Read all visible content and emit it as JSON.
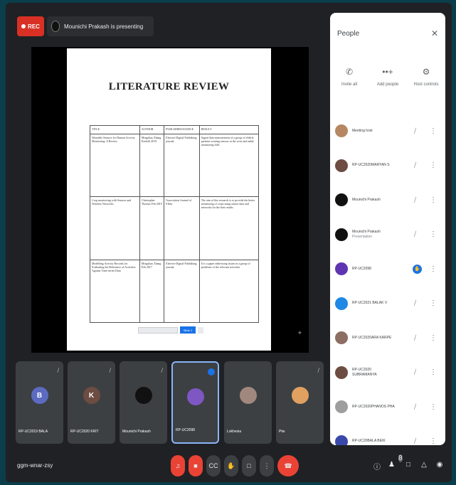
{
  "top": {
    "rec_label": "REC",
    "presenting_text": "Mounichi Prakash is presenting"
  },
  "slide": {
    "title": "LITERATURE REVIEW",
    "headers": [
      "TITLE",
      "AUTHOR",
      "PUBLISHED/SOURCE",
      "RESULT"
    ],
    "rows": [
      [
        "Wearable Sensors for Human Activity Monitoring: A Review",
        "Mingchao Zhang\n\nKatfold 2019",
        "Elsevier Digital Publishing journal",
        "Signal data measurement of a group of elderly patients wearing sensors at the wrist and ankle monitoring falls"
      ],
      [
        "Crop monitoring with Sensors and Wireless Networks",
        "Christopher Thomas\n\nFeb 2019",
        "Association Journal of Elbey",
        "The aim of this research is to provide the better monitoring of crops using sensor data and networks for the best results"
      ],
      [
        "Modelling Activity Records for Evaluating the Relevance of Activities Against Time-series Data",
        "Mingchao Zhang\n\nFeb 2017",
        "Elsevier Digital Publishing journal",
        "It is a paper addressing issues in a group of problems of the relevant activities"
      ]
    ],
    "page_label": "Slide 1"
  },
  "people_panel": {
    "title": "People",
    "actions": [
      {
        "icon": "person-add-icon",
        "label": "Invite all"
      },
      {
        "icon": "add-people-icon",
        "label": "Add people"
      },
      {
        "icon": "host-controls-icon",
        "label": "Host controls"
      }
    ],
    "participants": [
      {
        "name": "Meeting host",
        "sub": "",
        "initial": "",
        "color": "#b58863",
        "state": "mic-off"
      },
      {
        "name": "RP-UC2020MARYAN S",
        "sub": "",
        "initial": "",
        "color": "#6d4c41",
        "state": "mic-off"
      },
      {
        "name": "Mounichi Prakash",
        "sub": "",
        "initial": "",
        "color": "#111111",
        "state": "mic-off"
      },
      {
        "name": "Mounichi Prakash",
        "sub": "Presentation",
        "initial": "",
        "color": "#111111",
        "state": "mic-off"
      },
      {
        "name": "RP-UC2098",
        "sub": "",
        "initial": "",
        "color": "#5e35b1",
        "state": "hand"
      },
      {
        "name": "RP-UC2021 BALAK V",
        "sub": "",
        "initial": "",
        "color": "#1e88e5",
        "state": "mic-off"
      },
      {
        "name": "RP-UC2020ARA KARPE",
        "sub": "",
        "initial": "",
        "color": "#8d6e63",
        "state": "mic-off"
      },
      {
        "name": "RP-UC2020 SUBRAMANYA",
        "sub": "",
        "initial": "",
        "color": "#6d4c41",
        "state": "mic-off"
      },
      {
        "name": "RP-UC2020PHANOS PHA",
        "sub": "",
        "initial": "",
        "color": "#9e9e9e",
        "state": "mic-off"
      },
      {
        "name": "RP-UC20BALA BEIK",
        "sub": "",
        "initial": "",
        "color": "#3949ab",
        "state": "mic-off"
      }
    ]
  },
  "tiles": [
    {
      "name": "RP-UC2019 BALA",
      "initial": "B",
      "color": "#5c6bc0"
    },
    {
      "name": "RP-UC2020 KRIT",
      "initial": "K",
      "color": "#6d4c41"
    },
    {
      "name": "Mounichi Prakash",
      "initial": "",
      "color": "#111111"
    },
    {
      "name": "RP-UC2098",
      "initial": "",
      "color": "#7e57c2"
    },
    {
      "name": "Lokhesia",
      "initial": "",
      "color": "#a1887f"
    },
    {
      "name": "Ptw",
      "initial": "",
      "color": "#e0a060"
    }
  ],
  "bottom": {
    "meeting_code": "ggm-wnar-zsy",
    "people_count": "8"
  }
}
